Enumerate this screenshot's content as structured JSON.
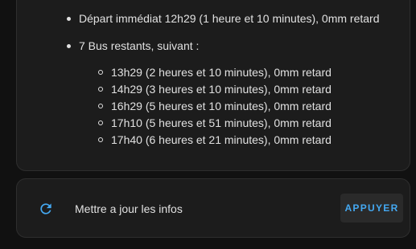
{
  "departures": {
    "immediate": "Départ immédiat 12h29 (1 heure et 10 minutes), 0mm retard",
    "remaining_header": "7 Bus restants, suivant :",
    "next": [
      "13h29 (2 heures et 10 minutes), 0mm retard",
      "14h29 (3 heures et 10 minutes), 0mm retard",
      "16h29 (5 heures et 10 minutes), 0mm retard",
      "17h10 (5 heures et 51 minutes), 0mm retard",
      "17h40 (6 heures et 21 minutes), 0mm retard"
    ]
  },
  "update_row": {
    "icon": "refresh-icon",
    "label": "Mettre a jour les infos",
    "button_label": "APPUYER",
    "accent_color": "#44a8f1"
  }
}
